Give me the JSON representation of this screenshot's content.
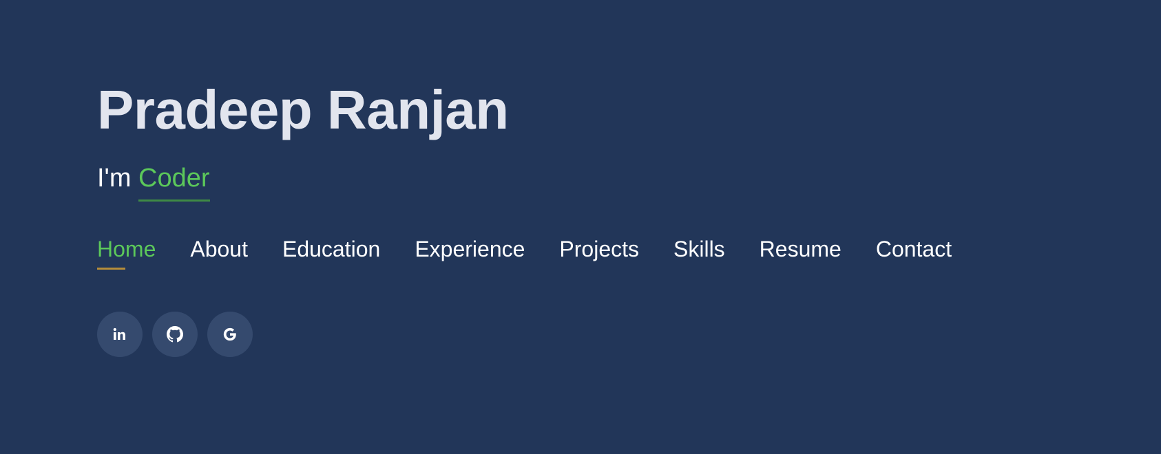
{
  "hero": {
    "name": "Pradeep Ranjan",
    "tagline_prefix": "I'm ",
    "tagline_role": "Coder"
  },
  "nav": {
    "items": [
      {
        "label": "Home",
        "active": true
      },
      {
        "label": "About"
      },
      {
        "label": "Education"
      },
      {
        "label": "Experience"
      },
      {
        "label": "Projects"
      },
      {
        "label": "Skills"
      },
      {
        "label": "Resume"
      },
      {
        "label": "Contact"
      }
    ]
  },
  "socials": [
    {
      "icon": "linkedin-icon"
    },
    {
      "icon": "github-icon"
    },
    {
      "icon": "google-icon"
    }
  ],
  "colors": {
    "background": "#223659",
    "accent_green": "#5cc85a",
    "nav_underline": "#b58d3a",
    "social_bg": "#354a6e"
  }
}
